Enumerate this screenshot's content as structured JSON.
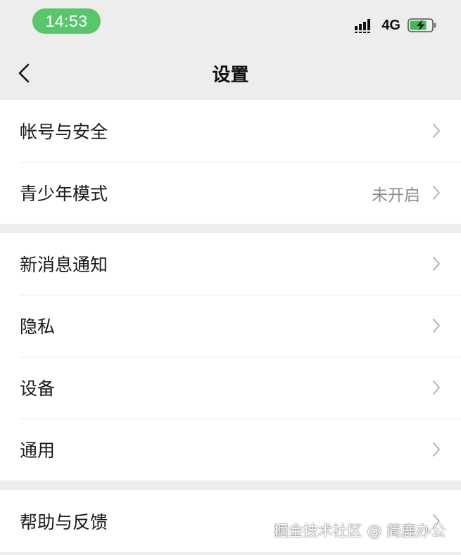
{
  "status_bar": {
    "time": "14:53",
    "network": "4G",
    "signal_icon": "signal-bars-icon",
    "battery_icon": "battery-charging-icon"
  },
  "nav": {
    "title": "设置",
    "back_icon": "back-arrow-icon"
  },
  "groups": [
    {
      "items": [
        {
          "label": "帐号与安全",
          "value": ""
        },
        {
          "label": "青少年模式",
          "value": "未开启"
        }
      ]
    },
    {
      "items": [
        {
          "label": "新消息通知",
          "value": ""
        },
        {
          "label": "隐私",
          "value": ""
        },
        {
          "label": "设备",
          "value": ""
        },
        {
          "label": "通用",
          "value": ""
        }
      ]
    },
    {
      "items": [
        {
          "label": "帮助与反馈",
          "value": ""
        }
      ]
    }
  ],
  "watermark": "掘金技术社区 @ 简鹿办公",
  "colors": {
    "background": "#ededed",
    "card": "#ffffff",
    "time_pill": "#58c66a",
    "battery_fill": "#3dbd4e",
    "secondary_text": "#8c8c8c"
  }
}
